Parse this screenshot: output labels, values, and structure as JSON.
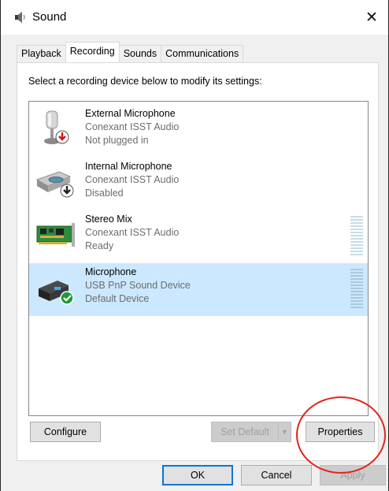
{
  "window": {
    "title": "Sound",
    "close_glyph": "✕",
    "icon": "speaker-icon"
  },
  "tabs": [
    {
      "label": "Playback",
      "active": false
    },
    {
      "label": "Recording",
      "active": true
    },
    {
      "label": "Sounds",
      "active": false
    },
    {
      "label": "Communications",
      "active": false
    }
  ],
  "instruction": "Select a recording device below to modify its settings:",
  "devices": [
    {
      "name": "External Microphone",
      "driver": "Conexant ISST Audio",
      "status": "Not plugged in",
      "icon": "external-microphone-icon",
      "badge": "unplugged-badge",
      "selected": false,
      "has_meter": false
    },
    {
      "name": "Internal Microphone",
      "driver": "Conexant ISST Audio",
      "status": "Disabled",
      "icon": "internal-microphone-icon",
      "badge": "disabled-badge",
      "selected": false,
      "has_meter": false
    },
    {
      "name": "Stereo Mix",
      "driver": "Conexant ISST Audio",
      "status": "Ready",
      "icon": "sound-card-icon",
      "badge": "",
      "selected": false,
      "has_meter": true
    },
    {
      "name": "Microphone",
      "driver": "USB PnP Sound Device",
      "status": "Default Device",
      "icon": "usb-sound-device-icon",
      "badge": "default-check-badge",
      "selected": true,
      "has_meter": true
    }
  ],
  "buttons": {
    "configure": "Configure",
    "set_default": "Set Default",
    "set_default_arrow": "▼",
    "properties": "Properties",
    "ok": "OK",
    "cancel": "Cancel",
    "apply": "Apply"
  },
  "colors": {
    "selection": "#cce8ff",
    "highlight_ring": "#e3231b",
    "default_check": "#1e9a3a",
    "unplugged": "#d2191a"
  }
}
